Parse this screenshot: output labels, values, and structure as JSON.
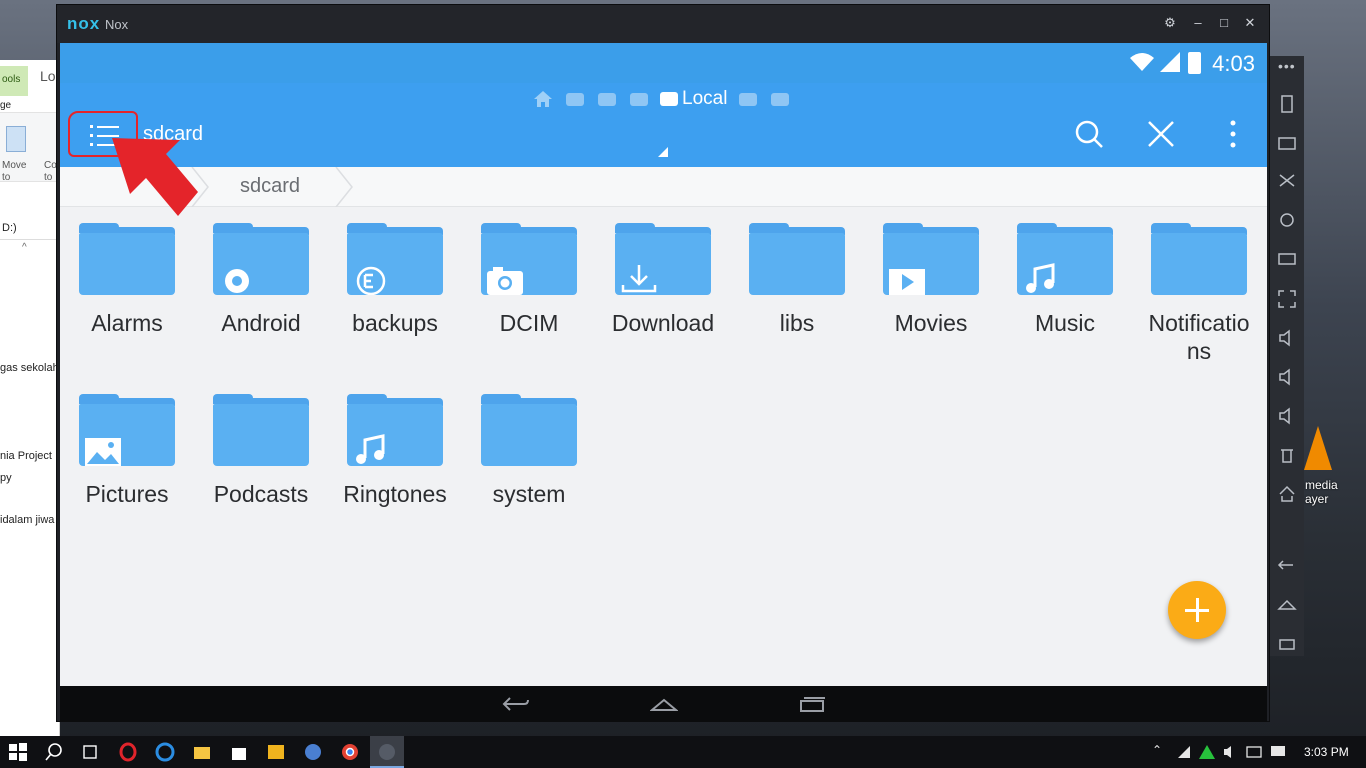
{
  "desktop": {
    "explorer": {
      "tools_tab": "ools",
      "location_tab": "Lo",
      "ribbon_tab": "ge",
      "move_to": "Move to",
      "copy_to": "Co to",
      "drive_path": "D:)",
      "items": [
        "gas sekolah",
        "nia Project",
        "py",
        "idalam jiwa"
      ]
    },
    "vlc_label": "media ayer"
  },
  "nox": {
    "logo": "nox",
    "title": "Nox",
    "window_buttons": [
      "settings",
      "minimize",
      "maximize",
      "close"
    ]
  },
  "android": {
    "status": {
      "time": "4:03"
    },
    "appbar": {
      "active_window_tab": "Local",
      "path": "sdcard"
    },
    "breadcrumb": {
      "current": "sdcard"
    },
    "folders": [
      {
        "label": "Alarms",
        "badge": ""
      },
      {
        "label": "Android",
        "badge": "gear"
      },
      {
        "label": "backups",
        "badge": "es"
      },
      {
        "label": "DCIM",
        "badge": "camera"
      },
      {
        "label": "Download",
        "badge": "download"
      },
      {
        "label": "libs",
        "badge": ""
      },
      {
        "label": "Movies",
        "badge": "play"
      },
      {
        "label": "Music",
        "badge": "music"
      },
      {
        "label": "Notificatio\nns",
        "badge": ""
      },
      {
        "label": "Pictures",
        "badge": "image"
      },
      {
        "label": "Podcasts",
        "badge": ""
      },
      {
        "label": "Ringtones",
        "badge": "music"
      },
      {
        "label": "system",
        "badge": ""
      }
    ]
  },
  "taskbar": {
    "clock": "3:03 PM"
  },
  "colors": {
    "appbar": "#3d9ff0",
    "status_bar": "#3b9eea",
    "folder": "#5ab0f2",
    "fab": "#fbab16",
    "annotation": "#e4242a"
  }
}
